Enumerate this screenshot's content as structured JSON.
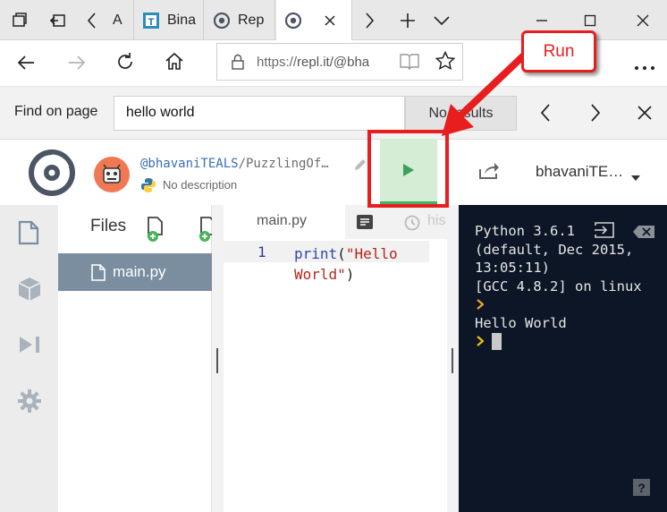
{
  "browser": {
    "tabs": [
      {
        "label": "A",
        "active": false
      },
      {
        "label": "Bina",
        "active": false
      },
      {
        "label": "Rep",
        "active": false
      },
      {
        "label": "",
        "active": true
      }
    ],
    "url_prefix": "https://",
    "url_host": "repl.it/@bha"
  },
  "find_bar": {
    "label": "Find on page",
    "query": "hello world",
    "result": "No results"
  },
  "repl": {
    "owner": "@bhavaniTEALS",
    "slug": "/PuzzlingOf…",
    "description": "No description",
    "user_name": "bhavaniTE…"
  },
  "files_panel": {
    "title": "Files",
    "items": [
      {
        "name": "main.py",
        "selected": true
      }
    ]
  },
  "editor": {
    "tab_label": "main.py",
    "history_label": "his",
    "line_numbers": [
      "1"
    ],
    "code_func": "print",
    "code_open": "(",
    "code_str_line1": "\"Hello",
    "code_str_line2": "World\"",
    "code_close": ")"
  },
  "console": {
    "lines": [
      "Python 3.6.1",
      "(default, Dec 2015,",
      "13:05:11)",
      "[GCC 4.8.2] on linux"
    ],
    "output": "Hello World",
    "help_label": "?"
  },
  "annotation": {
    "label": "Run",
    "color": "#e81d1d"
  },
  "colors": {
    "run_green": "#3fb464",
    "console_bg": "#0c1626",
    "file_selected_bg": "#7a8ea0",
    "link_blue": "#3a6fb5"
  },
  "icons": [
    "tab-manager-icon",
    "set-aside-tabs-icon",
    "scroll-left-icon",
    "close-tab-icon",
    "scroll-right-icon",
    "new-tab-icon",
    "tab-list-icon",
    "minimize-icon",
    "maximize-icon",
    "window-close-icon",
    "back-icon",
    "forward-icon",
    "refresh-icon",
    "home-icon",
    "lock-icon",
    "reading-view-icon",
    "favorite-icon",
    "more-icon",
    "find-previous-icon",
    "find-next-icon",
    "find-close-icon",
    "replit-logo-icon",
    "avatar-icon",
    "python-icon",
    "edit-pencil-icon",
    "run-play-icon",
    "share-icon",
    "dropdown-caret-icon",
    "files-icon",
    "packages-icon",
    "debugger-icon",
    "settings-gear-icon",
    "new-file-icon",
    "new-folder-icon",
    "file-icon",
    "format-icon",
    "history-icon",
    "console-input-icon",
    "console-clear-icon",
    "console-prompt-icon"
  ]
}
